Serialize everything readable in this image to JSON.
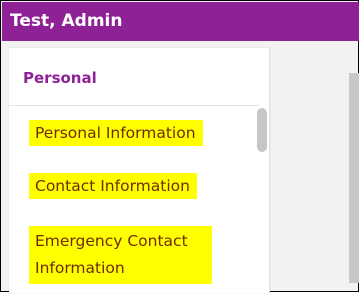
{
  "header": {
    "title": "Test, Admin"
  },
  "sidebar": {
    "section_label": "Personal",
    "items": [
      {
        "label": "Personal Information"
      },
      {
        "label": "Contact Information"
      },
      {
        "label": "Emergency Contact Information"
      }
    ]
  },
  "colors": {
    "brand_purple": "#8e2196",
    "highlight_yellow": "#ffff00"
  }
}
